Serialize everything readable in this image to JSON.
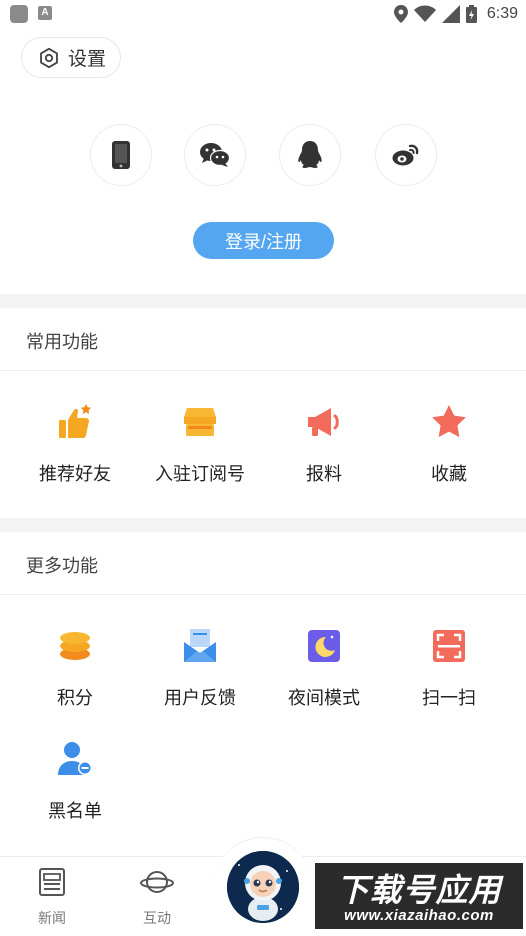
{
  "status_bar": {
    "time": "6:39",
    "left_icons": [
      "app-icon",
      "a-icon"
    ],
    "left_icon_text": "A",
    "right_icons": [
      "location-icon",
      "wifi-icon",
      "signal-icon",
      "battery-icon"
    ]
  },
  "header": {
    "settings_label": "设置",
    "settings_icon": "gear-icon"
  },
  "login": {
    "social_icons": [
      "phone-icon",
      "wechat-icon",
      "qq-icon",
      "weibo-icon"
    ],
    "button_label": "登录/注册",
    "accent": "#55a6f0"
  },
  "common_features": {
    "title": "常用功能",
    "items": [
      {
        "label": "推荐好友",
        "icon": "thumbs-up-icon",
        "color": "#f5a623"
      },
      {
        "label": "入驻订阅号",
        "icon": "store-icon",
        "color": "#f5a623"
      },
      {
        "label": "报料",
        "icon": "megaphone-icon",
        "color": "#f26b5b"
      },
      {
        "label": "收藏",
        "icon": "star-icon",
        "color": "#f26b5b"
      }
    ]
  },
  "more_features": {
    "title": "更多功能",
    "items": [
      {
        "label": "积分",
        "icon": "coins-icon",
        "color": "#f5a623"
      },
      {
        "label": "用户反馈",
        "icon": "mail-icon",
        "color": "#3d8ee8"
      },
      {
        "label": "夜间模式",
        "icon": "moon-icon",
        "color": "#6b5de8"
      },
      {
        "label": "扫一扫",
        "icon": "scan-icon",
        "color": "#f26b5b"
      },
      {
        "label": "黑名单",
        "icon": "block-user-icon",
        "color": "#3d8ee8"
      }
    ]
  },
  "bottom_nav": {
    "items": [
      {
        "label": "新闻",
        "icon": "newspaper-icon"
      },
      {
        "label": "互动",
        "icon": "planet-icon"
      }
    ],
    "center_icon": "astronaut-icon"
  },
  "watermark": {
    "title": "下载号应用",
    "url": "www.xiazaihao.com"
  }
}
